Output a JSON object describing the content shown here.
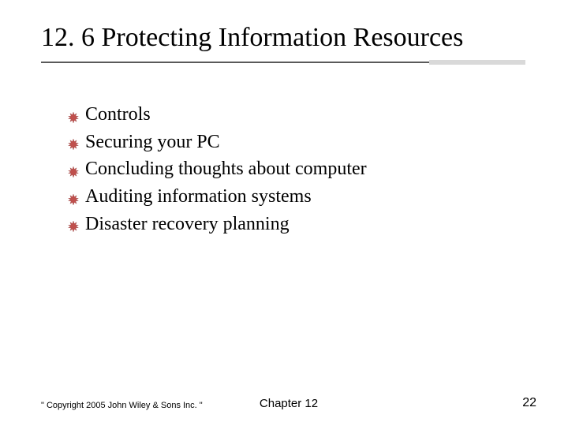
{
  "title": "12. 6 Protecting Information Resources",
  "bullets": [
    "Controls",
    "Securing your PC",
    "Concluding thoughts about computer",
    "Auditing information systems",
    "Disaster recovery planning"
  ],
  "footer": {
    "left": "\" Copyright 2005 John Wiley & Sons Inc. \"",
    "center": "Chapter 12",
    "right": "22"
  },
  "colors": {
    "bullet_fill": "#c0504d",
    "bullet_stroke": "#8b3a38"
  }
}
